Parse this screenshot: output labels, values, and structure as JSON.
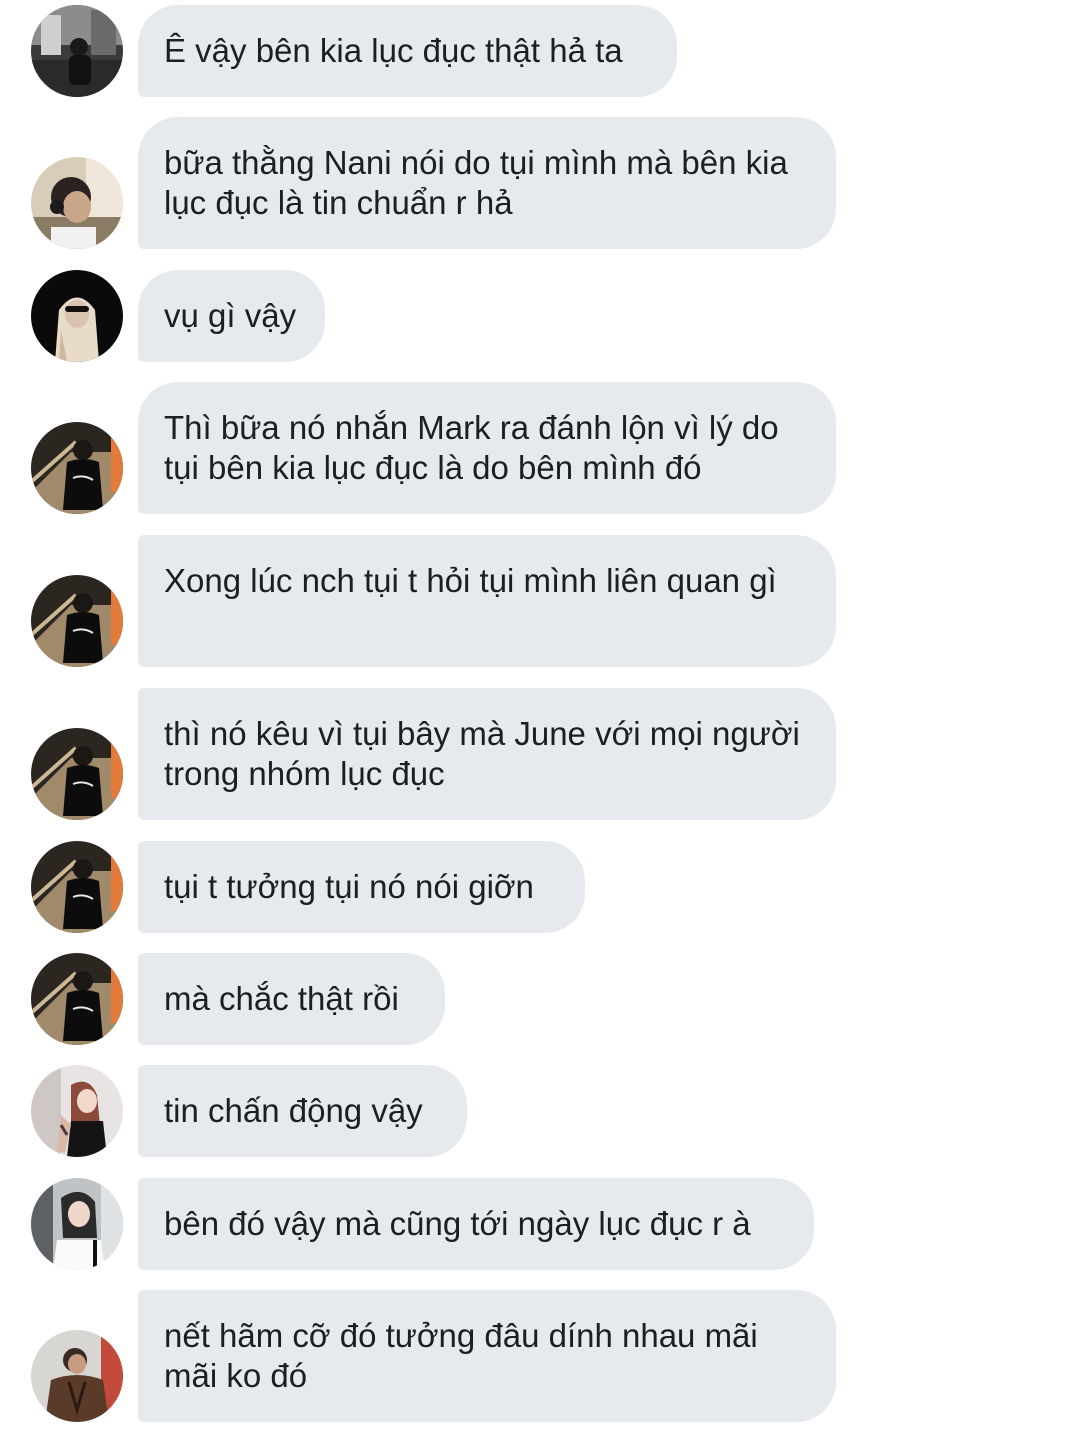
{
  "messages": [
    {
      "text": "Ê vậy bên kia lục đục thật hả ta",
      "avatar": "avatar-grayscale-street"
    },
    {
      "text": "bữa thằng Nani nói do tụi mình mà bên kia lục đục là tin chuẩn r hả",
      "avatar": "avatar-boy-headphones"
    },
    {
      "text": "vụ gì vậy",
      "avatar": "avatar-girl-dark"
    },
    {
      "text": "Thì bữa nó nhắn Mark ra đánh lộn vì lý do tụi bên kia lục đục là do bên mình đó",
      "avatar": "avatar-boy-stairs"
    },
    {
      "text": "Xong lúc nch tụi t hỏi tụi mình liên quan gì",
      "avatar": "avatar-boy-stairs"
    },
    {
      "text": "thì nó kêu vì tụi bây mà June với mọi người trong nhóm lục đục",
      "avatar": "avatar-boy-stairs"
    },
    {
      "text": "tụi t tưởng tụi nó nói giỡn",
      "avatar": "avatar-boy-stairs"
    },
    {
      "text": "mà chắc thật rồi",
      "avatar": "avatar-boy-stairs"
    },
    {
      "text": "tin chấn động vậy",
      "avatar": "avatar-girl-tattoo"
    },
    {
      "text": "bên đó vậy mà cũng tới ngày lục đục r à",
      "avatar": "avatar-girl-mirror"
    },
    {
      "text": "nết hãm cỡ đó tưởng đâu dính nhau mãi mãi ko đó",
      "avatar": "avatar-boy-jacket"
    }
  ],
  "colors": {
    "bubble_bg": "#e6eaee",
    "text": "#1c1e21",
    "background": "#ffffff"
  }
}
